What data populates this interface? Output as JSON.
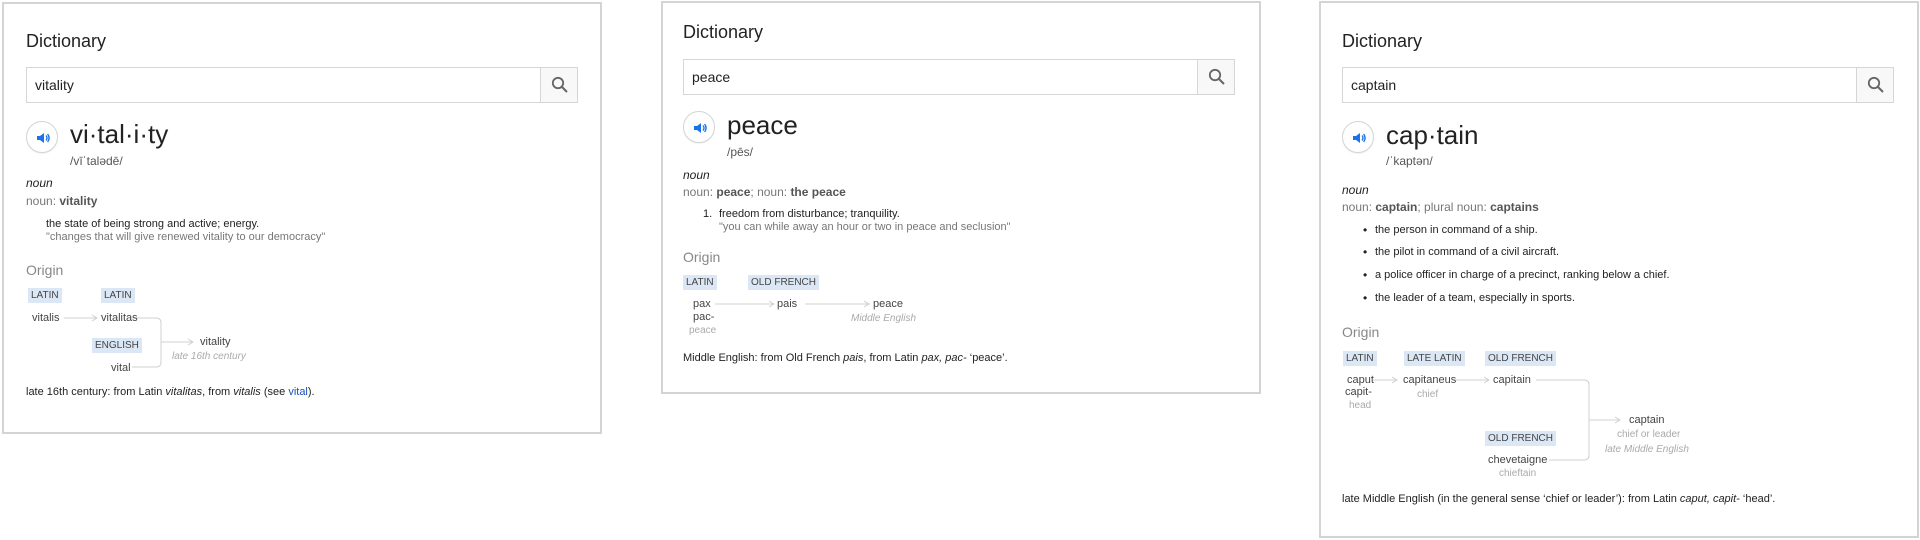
{
  "cards": [
    {
      "title": "Dictionary",
      "query": "vitality",
      "headword": "vi·tal·i·ty",
      "phonetic": "/vīˈtalədē/",
      "pos": "noun",
      "noun_prefix": "noun: ",
      "noun_form": "vitality",
      "definition": "the state of being strong and active; energy.",
      "example": "\"changes that will give renewed vitality to our democracy\"",
      "origin_heading": "Origin",
      "etymology": {
        "tags": [
          "LATIN",
          "LATIN",
          "ENGLISH"
        ],
        "words": [
          "vitalis",
          "vitalitas",
          "vital",
          "vitality"
        ],
        "when": "late 16th century"
      },
      "footer": {
        "pre": "late 16th century: from Latin ",
        "i1": "vitalitas",
        "mid": ", from ",
        "i2": "vitalis",
        "see": " (see ",
        "link": "vital",
        "end": ")."
      }
    },
    {
      "title": "Dictionary",
      "query": "peace",
      "headword": "peace",
      "phonetic": "/pēs/",
      "pos": "noun",
      "noun_prefix": "noun: ",
      "noun_form": "peace",
      "noun_sep": "; noun: ",
      "noun_form2": "the peace",
      "def_number": "1.",
      "definition": "freedom from disturbance; tranquility.",
      "example": "\"you can while away an hour or two in peace and seclusion\"",
      "origin_heading": "Origin",
      "etymology": {
        "tags": [
          "LATIN",
          "OLD FRENCH"
        ],
        "words": [
          "pax",
          "pac-",
          "pais",
          "peace"
        ],
        "gloss": "peace",
        "when": "Middle English"
      },
      "footer": {
        "pre": "Middle English: from Old French ",
        "i1": "pais",
        "mid": ", from Latin ",
        "i2": "pax, pac-",
        "end": " ‘peace’."
      }
    },
    {
      "title": "Dictionary",
      "query": "captain",
      "headword": "cap·tain",
      "phonetic": "/ˈkaptən/",
      "pos": "noun",
      "noun_prefix": "noun: ",
      "noun_form": "captain",
      "noun_sep": "; plural noun: ",
      "noun_form2": "captains",
      "senses": [
        "the person in command of a ship.",
        "the pilot in command of a civil aircraft.",
        "a police officer in charge of a precinct, ranking below a chief.",
        "the leader of a team, especially in sports."
      ],
      "origin_heading": "Origin",
      "etymology": {
        "tags": [
          "LATIN",
          "LATE LATIN",
          "OLD FRENCH",
          "OLD FRENCH"
        ],
        "words": [
          "caput",
          "capit-",
          "capitaneus",
          "capitain",
          "chevetaigne",
          "captain"
        ],
        "glosses": [
          "head",
          "chief",
          "chieftain",
          "chief or leader"
        ],
        "when": "late Middle English"
      },
      "footer": {
        "pre": "late Middle English (in the general sense ‘chief or leader’):  from Latin ",
        "i1": "caput, capit-",
        "end": " ‘head’."
      }
    }
  ],
  "icons": {
    "search": "search-icon",
    "speaker": "speaker-icon"
  },
  "colors": {
    "accent": "#1a73e8",
    "tag_bg": "#dbe7f5",
    "link": "#1a4fba",
    "border": "#d4d4d4"
  }
}
